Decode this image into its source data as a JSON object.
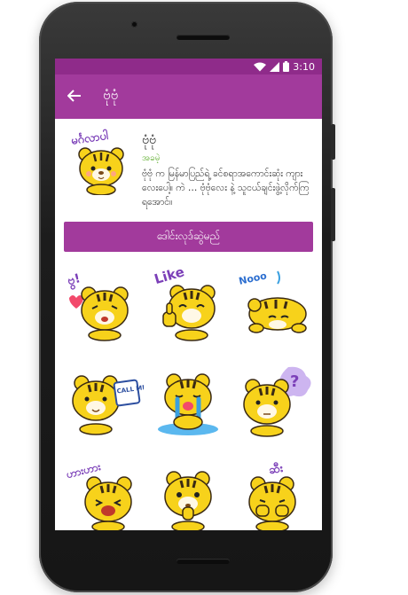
{
  "status_bar": {
    "time": "3:10",
    "icons": [
      "wifi-icon",
      "signal-icon",
      "battery-icon"
    ]
  },
  "app_bar": {
    "back_icon": "back-arrow-icon",
    "title": "ဗုံဗုံ"
  },
  "sticker_pack": {
    "name": "ဗုံဗုံ",
    "author": "အခမဲ့",
    "description": "ဗုံဗုံ က မြန်မာပြည်ရဲ့ ခင်စရာအကောင်းဆုံး ကျားလေးပေါ့။ ကဲ … ဗုံဗုံလေး နဲ့ သူငယ်ချင်းဖွဲ့လိုက်ကြရအောင်။",
    "download_label": "ဒေါင်းလုဒ်ဆွဲမည်"
  },
  "sticker_captions": {
    "thumb": "မင်္ဂလာပါ",
    "s1": "ဗွ!",
    "s2": "Like",
    "s3": "Nooo",
    "s4": "CALL ME",
    "s5": "",
    "s6": "?",
    "s7": "ဟားဟား",
    "s8": "",
    "s9": "ဆီး"
  },
  "colors": {
    "status_bar": "#8f2b8a",
    "app_bar": "#a23a9c",
    "button": "#a23a9c",
    "author_text": "#5fae2e",
    "tiger_yellow": "#f7d21b",
    "tiger_stripe": "#3a2a14"
  }
}
